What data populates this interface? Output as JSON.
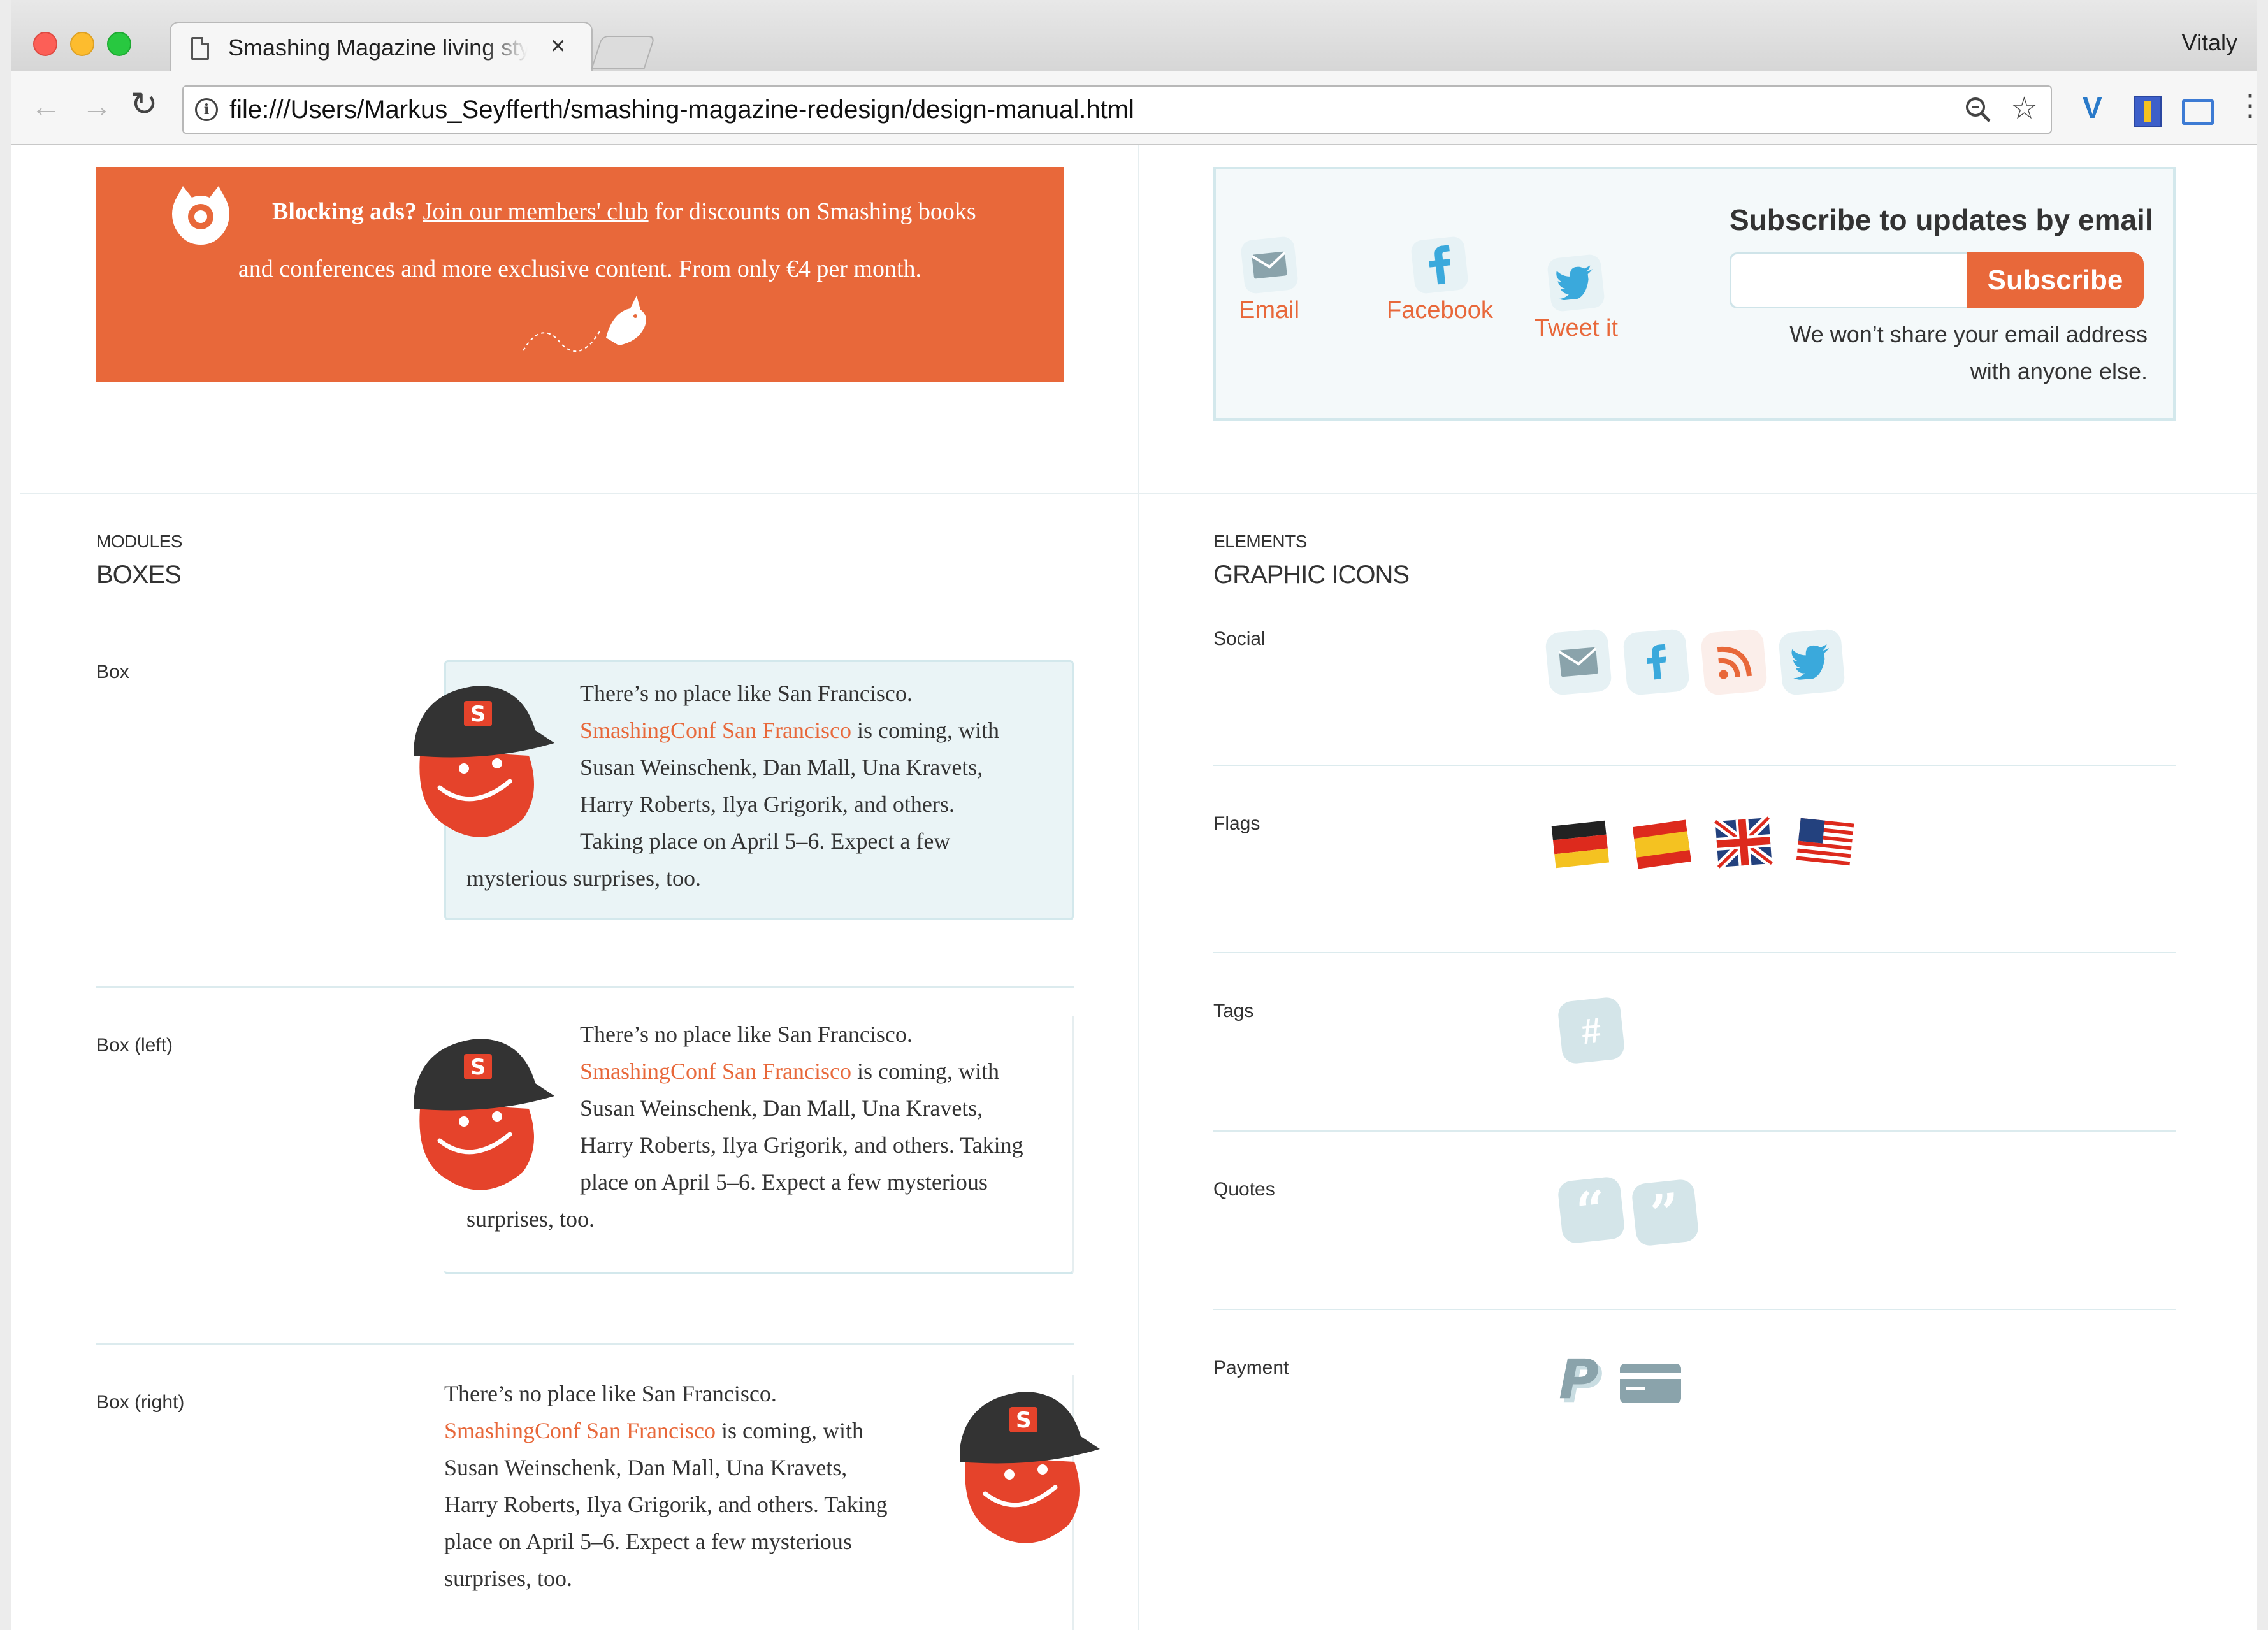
{
  "browser": {
    "tab_title": "Smashing Magazine living style guide",
    "tab_close": "×",
    "profile_name": "Vitaly",
    "url": "file:///Users/Markus_Seyfferth/smashing-magazine-redesign/design-manual.html"
  },
  "promo": {
    "bold": "Blocking ads?",
    "link": "Join our members' club",
    "rest_line1": " for discounts on Smashing books",
    "line2": "and conferences and more exclusive content. From only €4 per month."
  },
  "share": {
    "email_label": "Email",
    "facebook_label": "Facebook",
    "twitter_label": "Tweet it",
    "title": "Subscribe to updates by email",
    "input_value": "",
    "button": "Subscribe",
    "note_line1": "We won’t share your email address",
    "note_line2": "with anyone else."
  },
  "modules": {
    "kicker": "MODULES",
    "title": "BOXES",
    "rows": [
      {
        "label": "Box"
      },
      {
        "label": "Box (left)"
      },
      {
        "label": "Box (right)"
      }
    ],
    "box_text": {
      "intro": "There’s no place like San Francisco.",
      "link": "SmashingConf San Francisco",
      "after_link": " is coming, with",
      "line3": "Susan Weinschenk, Dan Mall, Una Kravets,",
      "line4a": "Harry Roberts, Ilya Grigorik, and others.",
      "line5a": "Taking place on April 5–6. Expect a few",
      "line6a": "mysterious surprises, too.",
      "line4b": "Harry Roberts, Ilya Grigorik, and others. Taking",
      "line5b": "place on April 5–6. Expect a few mysterious",
      "line6b": "surprises, too."
    }
  },
  "elements": {
    "kicker": "ELEMENTS",
    "title": "GRAPHIC ICONS",
    "rows": [
      {
        "label": "Social",
        "icons": [
          "email-icon",
          "facebook-icon",
          "rss-icon",
          "twitter-icon"
        ]
      },
      {
        "label": "Flags",
        "icons": [
          "german-flag-icon",
          "spanish-flag-icon",
          "uk-flag-icon",
          "us-flag-icon"
        ]
      },
      {
        "label": "Tags",
        "icons": [
          "hashtag-icon"
        ]
      },
      {
        "label": "Quotes",
        "icons": [
          "open-quote-icon",
          "close-quote-icon"
        ]
      },
      {
        "label": "Payment",
        "icons": [
          "paypal-icon",
          "credit-card-icon"
        ]
      }
    ]
  },
  "colors": {
    "accent": "#e8683a",
    "twitter": "#3aa9dc",
    "box_bg": "#eaf4f6",
    "icon_chip": "#e6f1f4"
  }
}
